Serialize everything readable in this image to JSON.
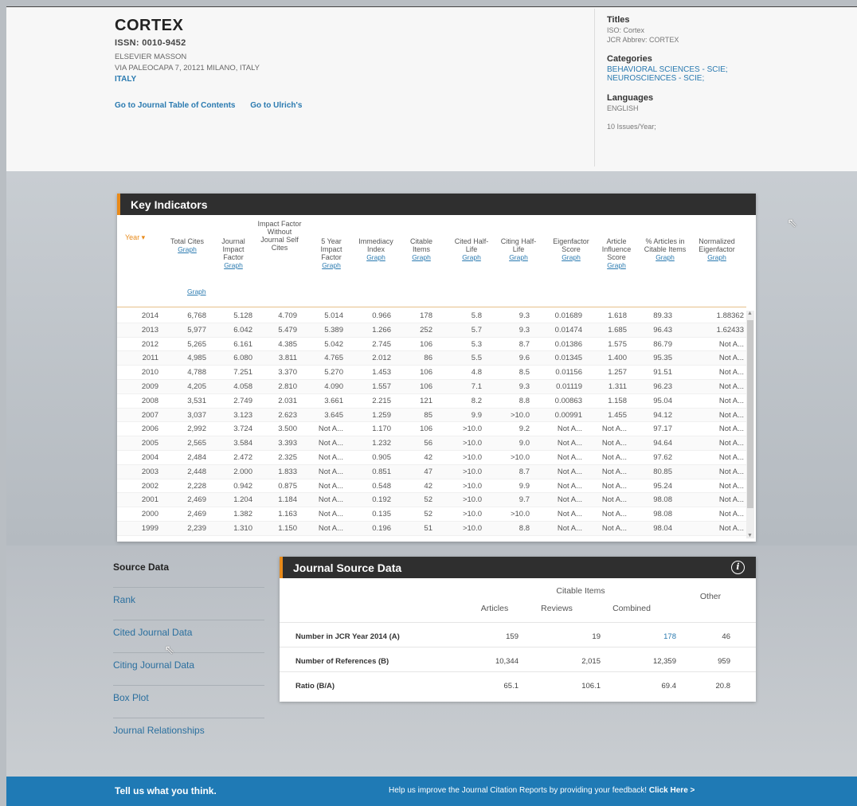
{
  "header": {
    "title": "CORTEX",
    "issn": "ISSN: 0010-9452",
    "publisher": "ELSEVIER MASSON",
    "address": "VIA PALEOCAPA 7, 20121 MILANO, ITALY",
    "country": "ITALY",
    "links": [
      "Go to Journal Table of Contents",
      "Go to Ulrich's"
    ],
    "titles_label": "Titles",
    "iso": "ISO: Cortex",
    "jcr_abbrev": "JCR Abbrev: CORTEX",
    "categories_label": "Categories",
    "categories": [
      "BEHAVIORAL SCIENCES - SCIE;",
      "NEUROSCIENCES - SCIE;"
    ],
    "languages_label": "Languages",
    "language": "ENGLISH",
    "issues": "10 Issues/Year;"
  },
  "key_indicators": {
    "title": "Key Indicators",
    "graph_label": "Graph",
    "columns": [
      {
        "label": "Year ▾",
        "graph": ""
      },
      {
        "label": "Total Cites",
        "graph": "Graph"
      },
      {
        "label": "Journal Impact Factor",
        "graph": "Graph"
      },
      {
        "label": "Impact Factor Without Journal Self Cites",
        "graph": ""
      },
      {
        "label": "5 Year Impact Factor",
        "graph": "Graph"
      },
      {
        "label": "Immediacy Index",
        "graph": "Graph"
      },
      {
        "label": "Citable Items",
        "graph": "Graph"
      },
      {
        "label": "Cited Half-Life",
        "graph": "Graph"
      },
      {
        "label": "Citing Half-Life",
        "graph": "Graph"
      },
      {
        "label": "Eigenfactor Score",
        "graph": "Graph"
      },
      {
        "label": "Article Influence Score",
        "graph": "Graph"
      },
      {
        "label": "% Articles in Citable Items",
        "graph": "Graph"
      },
      {
        "label": "Normalized Eigenfactor",
        "graph": "Graph"
      }
    ],
    "rows": [
      [
        "2014",
        "6,768",
        "5.128",
        "4.709",
        "5.014",
        "0.966",
        "178",
        "5.8",
        "9.3",
        "0.01689",
        "1.618",
        "89.33",
        "1.88362"
      ],
      [
        "2013",
        "5,977",
        "6.042",
        "5.479",
        "5.389",
        "1.266",
        "252",
        "5.7",
        "9.3",
        "0.01474",
        "1.685",
        "96.43",
        "1.62433"
      ],
      [
        "2012",
        "5,265",
        "6.161",
        "4.385",
        "5.042",
        "2.745",
        "106",
        "5.3",
        "8.7",
        "0.01386",
        "1.575",
        "86.79",
        "Not A..."
      ],
      [
        "2011",
        "4,985",
        "6.080",
        "3.811",
        "4.765",
        "2.012",
        "86",
        "5.5",
        "9.6",
        "0.01345",
        "1.400",
        "95.35",
        "Not A..."
      ],
      [
        "2010",
        "4,788",
        "7.251",
        "3.370",
        "5.270",
        "1.453",
        "106",
        "4.8",
        "8.5",
        "0.01156",
        "1.257",
        "91.51",
        "Not A..."
      ],
      [
        "2009",
        "4,205",
        "4.058",
        "2.810",
        "4.090",
        "1.557",
        "106",
        "7.1",
        "9.3",
        "0.01119",
        "1.311",
        "96.23",
        "Not A..."
      ],
      [
        "2008",
        "3,531",
        "2.749",
        "2.031",
        "3.661",
        "2.215",
        "121",
        "8.2",
        "8.8",
        "0.00863",
        "1.158",
        "95.04",
        "Not A..."
      ],
      [
        "2007",
        "3,037",
        "3.123",
        "2.623",
        "3.645",
        "1.259",
        "85",
        "9.9",
        ">10.0",
        "0.00991",
        "1.455",
        "94.12",
        "Not A..."
      ],
      [
        "2006",
        "2,992",
        "3.724",
        "3.500",
        "Not A...",
        "1.170",
        "106",
        ">10.0",
        "9.2",
        "Not A...",
        "Not A...",
        "97.17",
        "Not A..."
      ],
      [
        "2005",
        "2,565",
        "3.584",
        "3.393",
        "Not A...",
        "1.232",
        "56",
        ">10.0",
        "9.0",
        "Not A...",
        "Not A...",
        "94.64",
        "Not A..."
      ],
      [
        "2004",
        "2,484",
        "2.472",
        "2.325",
        "Not A...",
        "0.905",
        "42",
        ">10.0",
        ">10.0",
        "Not A...",
        "Not A...",
        "97.62",
        "Not A..."
      ],
      [
        "2003",
        "2,448",
        "2.000",
        "1.833",
        "Not A...",
        "0.851",
        "47",
        ">10.0",
        "8.7",
        "Not A...",
        "Not A...",
        "80.85",
        "Not A..."
      ],
      [
        "2002",
        "2,228",
        "0.942",
        "0.875",
        "Not A...",
        "0.548",
        "42",
        ">10.0",
        "9.9",
        "Not A...",
        "Not A...",
        "95.24",
        "Not A..."
      ],
      [
        "2001",
        "2,469",
        "1.204",
        "1.184",
        "Not A...",
        "0.192",
        "52",
        ">10.0",
        "9.7",
        "Not A...",
        "Not A...",
        "98.08",
        "Not A..."
      ],
      [
        "2000",
        "2,469",
        "1.382",
        "1.163",
        "Not A...",
        "0.135",
        "52",
        ">10.0",
        ">10.0",
        "Not A...",
        "Not A...",
        "98.08",
        "Not A..."
      ],
      [
        "1999",
        "2,239",
        "1.310",
        "1.150",
        "Not A...",
        "0.196",
        "51",
        ">10.0",
        "8.8",
        "Not A...",
        "Not A...",
        "98.04",
        "Not A..."
      ]
    ]
  },
  "sidenav": {
    "items": [
      "Source Data",
      "Rank",
      "Cited Journal Data",
      "Citing Journal Data",
      "Box Plot",
      "Journal Relationships"
    ]
  },
  "journal_source": {
    "title": "Journal Source Data",
    "info_icon": "info-icon",
    "group_header": "Citable Items",
    "headers": [
      "Articles",
      "Reviews",
      "Combined",
      "Other"
    ],
    "rows": [
      {
        "label": "Number in JCR Year 2014 (A)",
        "values": [
          "159",
          "19",
          "178",
          "46"
        ]
      },
      {
        "label": "Number of References (B)",
        "values": [
          "10,344",
          "2,015",
          "12,359",
          "959"
        ]
      },
      {
        "label": "Ratio (B/A)",
        "values": [
          "65.1",
          "106.1",
          "69.4",
          "20.8"
        ]
      }
    ]
  },
  "footer": {
    "left": "Tell us what you think.",
    "right": "Help us improve the Journal Citation Reports by providing your feedback!",
    "cta": "Click Here >"
  },
  "colors": {
    "accent_orange": "#e88a1a",
    "link_blue": "#2a7ab0",
    "footer_blue": "#1f7ab5",
    "panel_dark": "#2f2f2f"
  }
}
